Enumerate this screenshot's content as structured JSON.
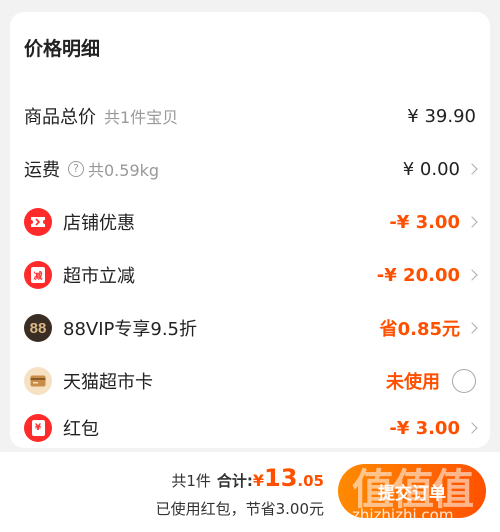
{
  "card": {
    "title": "价格明细",
    "rows": {
      "goods": {
        "label": "商品总价",
        "sub": "共1件宝贝",
        "amount": "¥ 39.90"
      },
      "shipping": {
        "label": "运费",
        "help_icon": "?",
        "sub": "共0.59kg",
        "amount": "¥ 0.00"
      },
      "shop_discount": {
        "label": "店铺优惠",
        "amount": "-¥ 3.00",
        "icon": "coupon-icon"
      },
      "supermarket_cut": {
        "label": "超市立减",
        "amount": "-¥ 20.00",
        "icon": "minus-tag-icon",
        "icon_text": "减"
      },
      "vip": {
        "label": "88VIP专享9.5折",
        "amount": "省0.85元",
        "icon": "vip-88-icon",
        "icon_text": "88"
      },
      "card": {
        "label": "天猫超市卡",
        "amount": "未使用",
        "icon": "card-icon"
      },
      "red_packet": {
        "label": "红包",
        "amount": "-¥ 3.00",
        "icon": "red-packet-icon",
        "icon_text": "¥"
      }
    }
  },
  "bottom": {
    "count": "共1件",
    "sum_label": "合计:",
    "yen": "¥",
    "int": "13",
    "dec": ".05",
    "saving": "已使用红包，节省3.00元",
    "submit": "提交订单"
  },
  "watermark": {
    "logo": "值值值",
    "url": "zhizhizhi.com"
  },
  "colors": {
    "accent": "#ff5000",
    "red_icon": "#ff2a2a",
    "vip_bg": "#3a2d24",
    "card_bg": "#f6e1c2"
  }
}
